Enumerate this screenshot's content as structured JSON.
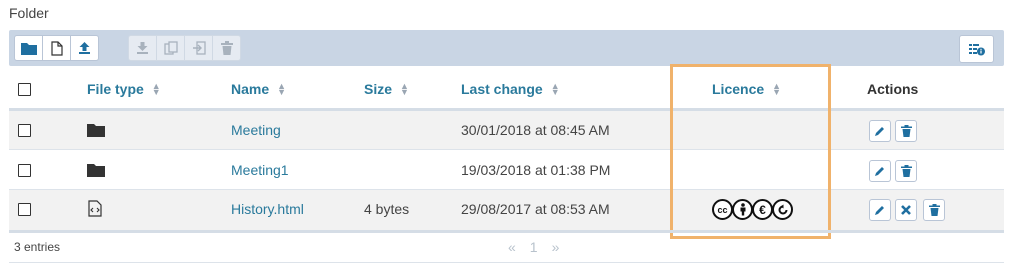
{
  "folder_title": "Folder",
  "toolbar": {
    "buttons": [
      {
        "name": "folder-icon",
        "enabled": true
      },
      {
        "name": "new-file-icon",
        "enabled": true
      },
      {
        "name": "upload-icon",
        "enabled": true
      },
      {
        "name": "download-icon",
        "enabled": false
      },
      {
        "name": "copy-icon",
        "enabled": false
      },
      {
        "name": "move-icon",
        "enabled": false
      },
      {
        "name": "trash-icon",
        "enabled": false
      }
    ],
    "right_button": "details-view-icon"
  },
  "table": {
    "headers": {
      "file_type": "File type",
      "name": "Name",
      "size": "Size",
      "last_change": "Last change",
      "licence": "Licence",
      "actions": "Actions"
    },
    "rows": [
      {
        "type_icon": "folder-icon",
        "name": "Meeting",
        "size": "",
        "last_change": "30/01/2018 at 08:45 AM",
        "licence": "",
        "actions": [
          "edit-icon",
          "trash-icon"
        ]
      },
      {
        "type_icon": "folder-icon",
        "name": "Meeting1",
        "size": "",
        "last_change": "19/03/2018 at 01:38 PM",
        "licence": "",
        "actions": [
          "edit-icon",
          "trash-icon"
        ]
      },
      {
        "type_icon": "html-file-icon",
        "name": "History.html",
        "size": "4 bytes",
        "last_change": "29/08/2017 at 08:53 AM",
        "licence": "cc-by-nc-sa",
        "actions": [
          "edit-icon",
          "close-icon",
          "trash-icon"
        ]
      }
    ]
  },
  "licence_badge": [
    "cc",
    "by",
    "nc",
    "sa"
  ],
  "footer": {
    "entries": "3 entries",
    "prev": "«",
    "page": "1",
    "next": "»"
  },
  "colors": {
    "link": "#2a7a9c",
    "toolbar_bg": "#c9d5e4",
    "highlight_box": "#f0b26b"
  }
}
